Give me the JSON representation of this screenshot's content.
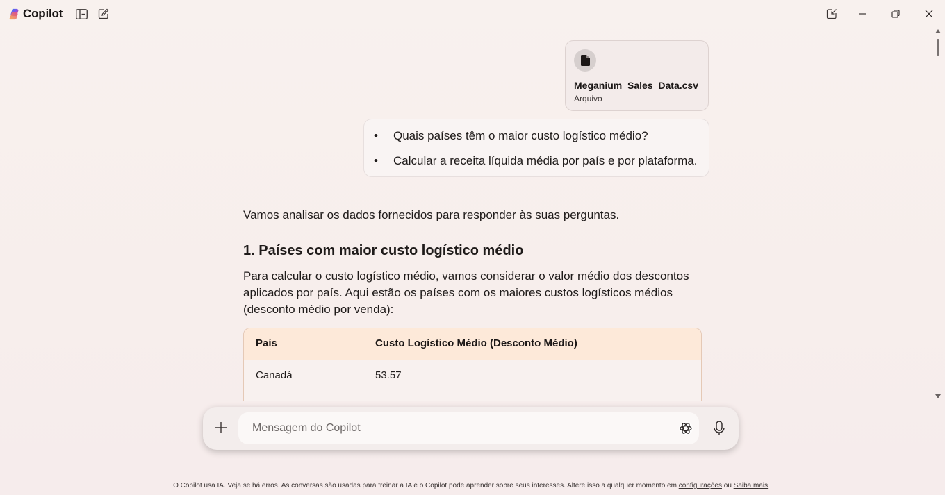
{
  "app": {
    "title": "Copilot"
  },
  "titlebar": {
    "icons": [
      "sidebar-icon",
      "new-chat-icon",
      "pin-icon",
      "minimize-icon",
      "restore-icon",
      "close-icon"
    ]
  },
  "attachment": {
    "file_name": "Meganium_Sales_Data.csv",
    "file_type": "Arquivo",
    "icon": "document-icon"
  },
  "user_message": {
    "bullets": [
      "Quais países têm o maior custo logístico médio?",
      "Calcular a receita líquida média por país e por plataforma."
    ]
  },
  "assistant": {
    "intro": "Vamos analisar os dados fornecidos para responder às suas perguntas.",
    "heading": "1. Países com maior custo logístico médio",
    "paragraph": "Para calcular o custo logístico médio, vamos considerar o valor médio dos descontos aplicados por país. Aqui estão os países com os maiores custos logísticos médios (desconto médio por venda):",
    "table": {
      "headers": [
        "País",
        "Custo Logístico Médio (Desconto Médio)"
      ],
      "rows": [
        [
          "Canadá",
          "53.57"
        ],
        [
          "",
          ""
        ]
      ]
    }
  },
  "composer": {
    "placeholder": "Mensagem do Copilot"
  },
  "footer": {
    "text": "O Copilot usa IA. Veja se há erros. As conversas são usadas para treinar a IA e o Copilot pode aprender sobre seus interesses. Altere isso a qualquer momento em",
    "link1": "configurações",
    "between": "ou",
    "link2": "Saiba mais",
    "end": "."
  },
  "colors": {
    "accent_header": "#fde9d9",
    "table_border": "#e5c9b6",
    "background": "#f8f1ee"
  }
}
